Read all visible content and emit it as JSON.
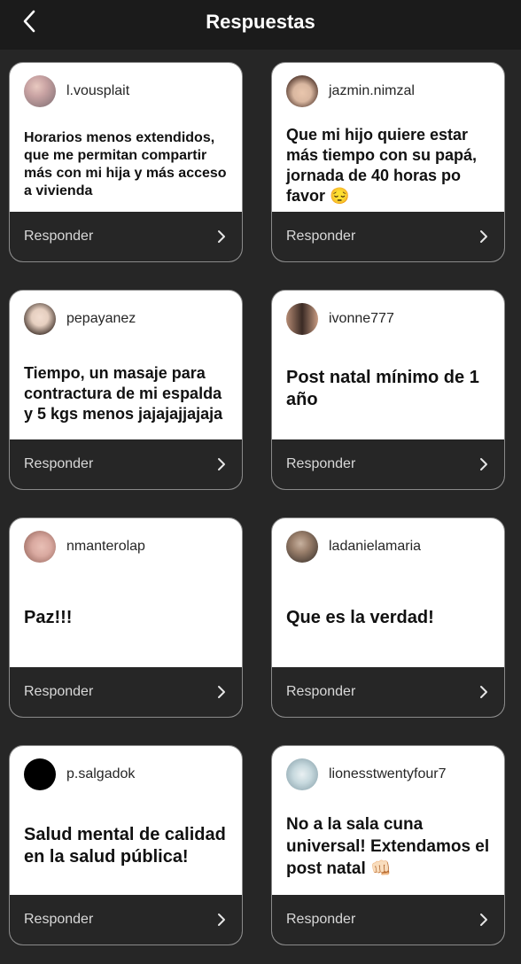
{
  "header": {
    "title": "Respuestas"
  },
  "reply_label": "Responder",
  "cards": [
    {
      "username": "l.vousplait",
      "answer": "Horarios menos extendidos, que me permitan compartir más con mi hija y más acceso a vivienda",
      "avatar_colors": [
        "#c9a3a3",
        "#7a6b70"
      ]
    },
    {
      "username": "jazmin.nimzal",
      "answer": "Que mi hijo quiere estar más tiempo con su papá, jornada de 40 horas po favor 😔",
      "avatar_colors": [
        "#d9b7a0",
        "#5a3f34"
      ]
    },
    {
      "username": "pepayanez",
      "answer": "Tiempo, un masaje para contractura de mi espalda y 5 kgs menos jajajajjajaja",
      "avatar_colors": [
        "#e6cfc0",
        "#3e3029"
      ]
    },
    {
      "username": "ivonne777",
      "answer": "Post natal mínimo de 1 año",
      "avatar_colors": [
        "#b58b74",
        "#3a2a24"
      ]
    },
    {
      "username": "nmanterolap",
      "answer": "Paz!!!",
      "avatar_colors": [
        "#d9a9a0",
        "#8a5a50"
      ]
    },
    {
      "username": "ladanielamaria",
      "answer": "Que es la verdad!",
      "avatar_colors": [
        "#9a7f6b",
        "#2e2824"
      ]
    },
    {
      "username": "p.salgadok",
      "answer": "Salud mental de calidad en la salud pública!",
      "avatar_colors": [
        "#000000",
        "#000000"
      ]
    },
    {
      "username": "lionesstwentyfour7",
      "answer": "No a la sala cuna universal! Extendamos el post natal 👊🏻",
      "avatar_colors": [
        "#c7d9de",
        "#7f99a3"
      ]
    }
  ]
}
